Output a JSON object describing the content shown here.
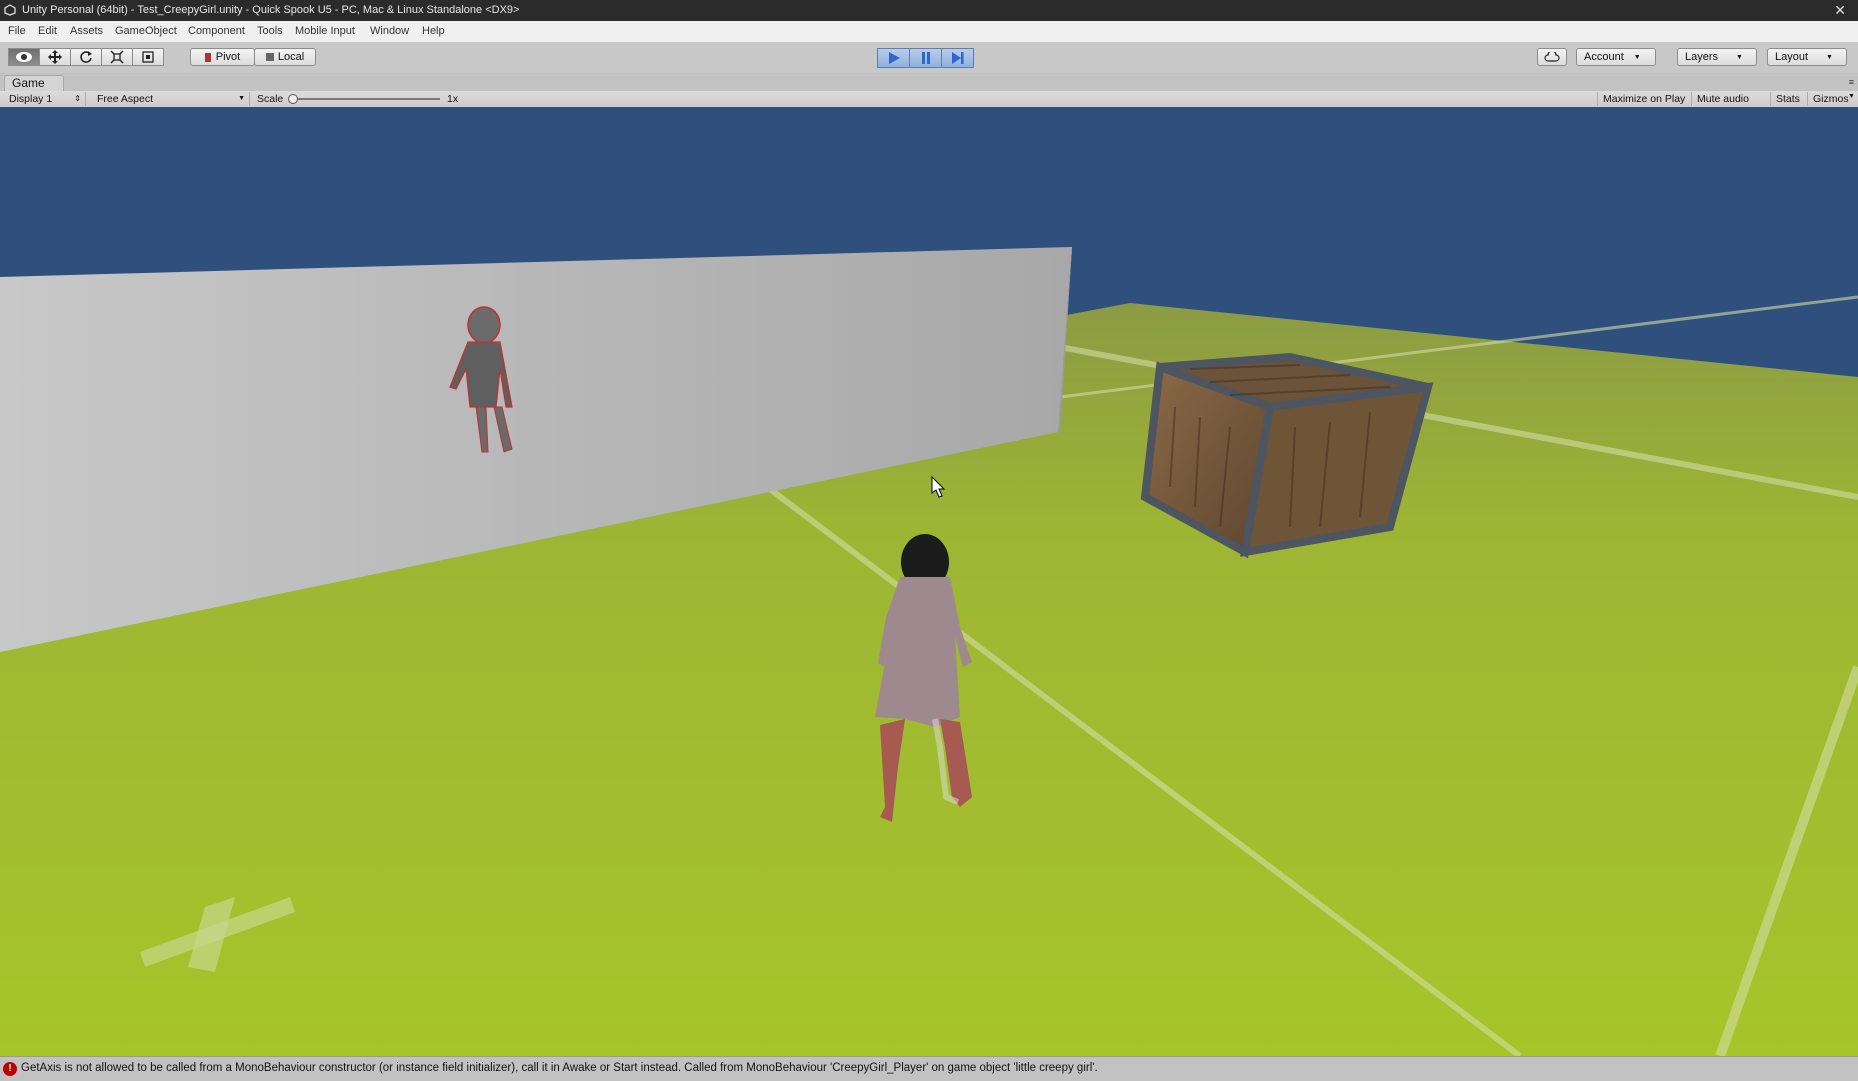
{
  "window": {
    "title": "Unity Personal (64bit) - Test_CreepyGirl.unity - Quick Spook U5 - PC, Mac & Linux Standalone <DX9>",
    "close_glyph": "✕"
  },
  "menu": [
    "File",
    "Edit",
    "Assets",
    "GameObject",
    "Component",
    "Tools",
    "Mobile Input",
    "Window",
    "Help"
  ],
  "toolbar": {
    "tools": [
      "hand-icon",
      "move-icon",
      "rotate-icon",
      "scale-icon",
      "rect-tool-icon"
    ],
    "pivot_label": "Pivot",
    "local_label": "Local",
    "playback": [
      "play-icon",
      "pause-icon",
      "step-icon"
    ],
    "account_label": "Account",
    "layers_label": "Layers",
    "layout_label": "Layout",
    "accent_color": "#3a6fd0"
  },
  "game_view": {
    "tab_label": "Game",
    "display_label": "Display 1",
    "aspect_label": "Free Aspect",
    "scale_label": "Scale",
    "scale_value": "1x",
    "toggles": [
      "Maximize on Play",
      "Mute audio",
      "Stats",
      "Gizmos"
    ]
  },
  "status": {
    "icon": "error-icon",
    "message": "GetAxis is not allowed to be called from a MonoBehaviour constructor (or instance field initializer), call it in Awake or Start instead. Called from MonoBehaviour 'CreepyGirl_Player' on game object 'little creepy girl'."
  },
  "colors": {
    "sky": "#2f4f7c",
    "ground": "#9fbf22",
    "wall": "#bcbcbc",
    "error": "#b00000"
  }
}
